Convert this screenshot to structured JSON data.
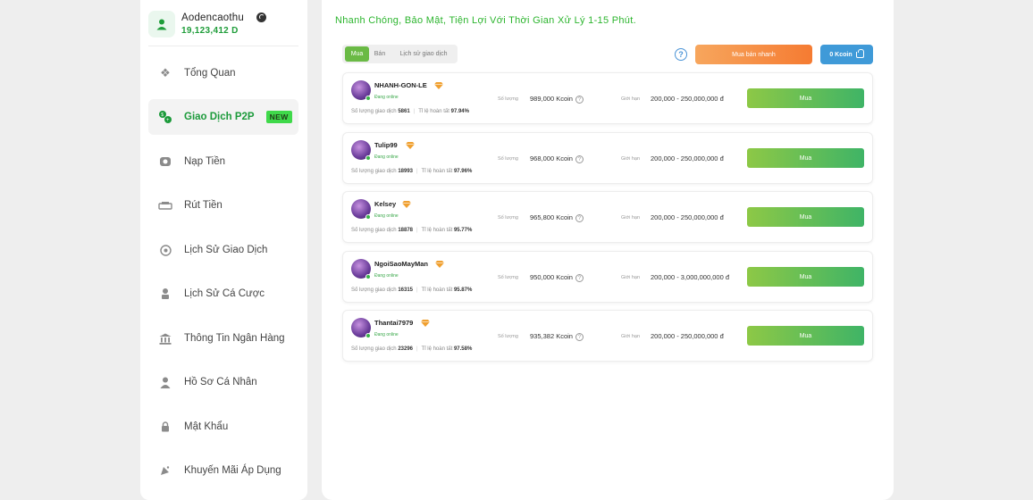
{
  "user": {
    "name": "Aodencaothu",
    "balance": "19,123,412 D"
  },
  "sidebar": {
    "items": [
      {
        "label": "Tổng Quan",
        "icon": "dashboard-icon"
      },
      {
        "label": "Giao Dịch P2P",
        "icon": "p2p-icon",
        "active": true,
        "badge": "NEW"
      },
      {
        "label": "Nạp Tiền",
        "icon": "deposit-icon"
      },
      {
        "label": "Rút Tiền",
        "icon": "withdraw-icon"
      },
      {
        "label": "Lịch Sử Giao Dịch",
        "icon": "history-icon"
      },
      {
        "label": "Lịch Sử Cá Cược",
        "icon": "bet-history-icon"
      },
      {
        "label": "Thông Tin Ngân Hàng",
        "icon": "bank-icon"
      },
      {
        "label": "Hồ Sơ Cá Nhân",
        "icon": "profile-icon"
      },
      {
        "label": "Mật Khẩu",
        "icon": "lock-icon"
      },
      {
        "label": "Khuyến Mãi Áp Dụng",
        "icon": "promo-icon"
      }
    ]
  },
  "main": {
    "headline": "Nhanh Chóng, Bảo Mật, Tiện Lợi Với Thời Gian Xử Lý 1-15 Phút.",
    "tabs": [
      {
        "label": "Mua",
        "active": true
      },
      {
        "label": "Bán"
      },
      {
        "label": "Lịch sử giao dịch"
      }
    ],
    "quick_button": "Mua bán nhanh",
    "kcoin_button": "0 Kcoin",
    "labels": {
      "online": "Đang online",
      "trades": "Số lượng giao dịch",
      "rate": "Tỉ lệ hoàn tất",
      "quantity": "Số lượng",
      "limit": "Giới hạn",
      "buy": "Mua"
    },
    "offers": [
      {
        "name": "NHANH-GON-LE",
        "trades": "5861",
        "rate": "97.94%",
        "quantity": "989,000 Kcoin",
        "limit": "200,000 - 250,000,000 đ"
      },
      {
        "name": "Tulip99",
        "trades": "18993",
        "rate": "97.96%",
        "quantity": "968,000 Kcoin",
        "limit": "200,000 - 250,000,000 đ"
      },
      {
        "name": "Kelsey",
        "trades": "18878",
        "rate": "95.77%",
        "quantity": "965,800 Kcoin",
        "limit": "200,000 - 250,000,000 đ"
      },
      {
        "name": "NgoiSaoMayMan",
        "trades": "16315",
        "rate": "95.87%",
        "quantity": "950,000 Kcoin",
        "limit": "200,000 - 3,000,000,000 đ"
      },
      {
        "name": "Thantai7979",
        "trades": "23296",
        "rate": "97.58%",
        "quantity": "935,382 Kcoin",
        "limit": "200,000 - 250,000,000 đ"
      }
    ]
  }
}
